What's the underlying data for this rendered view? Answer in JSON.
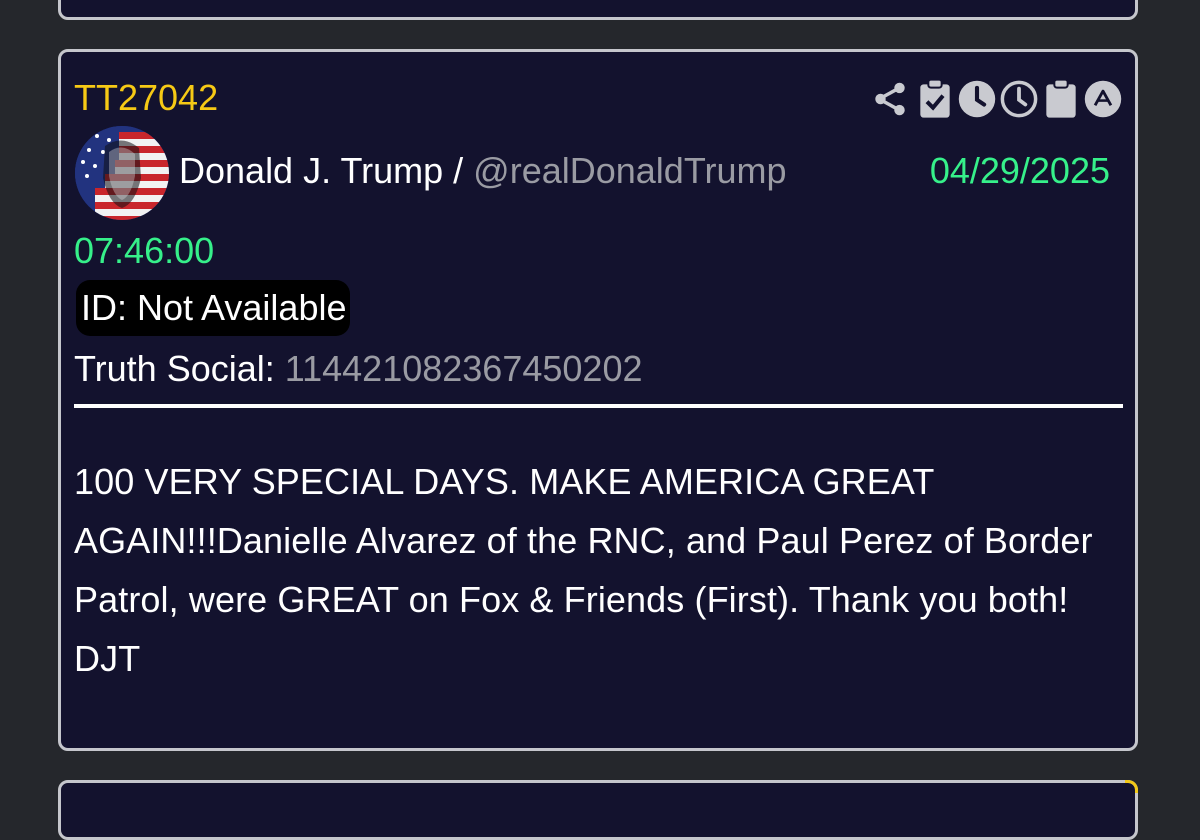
{
  "post": {
    "code": "TT27042",
    "author_name": "Donald J. Trump",
    "separator": "/",
    "handle": "@realDonaldTrump",
    "date": "04/29/2025",
    "time": "07:46:00",
    "id_label": "ID: Not Available",
    "truth_social_label": "Truth Social:",
    "truth_social_id": "114421082367450202",
    "body": "100 VERY SPECIAL DAYS. MAKE AMERICA GREAT AGAIN!!!Danielle Alvarez of the RNC, and Paul Perez of Border Patrol, were GREAT on Fox & Friends (First). Thank you both! DJT"
  },
  "actions": [
    {
      "icon": "share-icon"
    },
    {
      "icon": "clipboard-check-icon"
    },
    {
      "icon": "clock-filled-icon"
    },
    {
      "icon": "clock-outline-icon"
    },
    {
      "icon": "clipboard-icon"
    },
    {
      "icon": "caret-up-circle-icon"
    }
  ],
  "colors": {
    "page_bg": "#25272c",
    "card_bg": "#13122e",
    "card_border": "#c5c6cc",
    "code": "#f6c915",
    "date_time": "#36f08a",
    "handle": "#9a9ba3",
    "text": "#ffffff",
    "icon": "#c9cad0"
  }
}
